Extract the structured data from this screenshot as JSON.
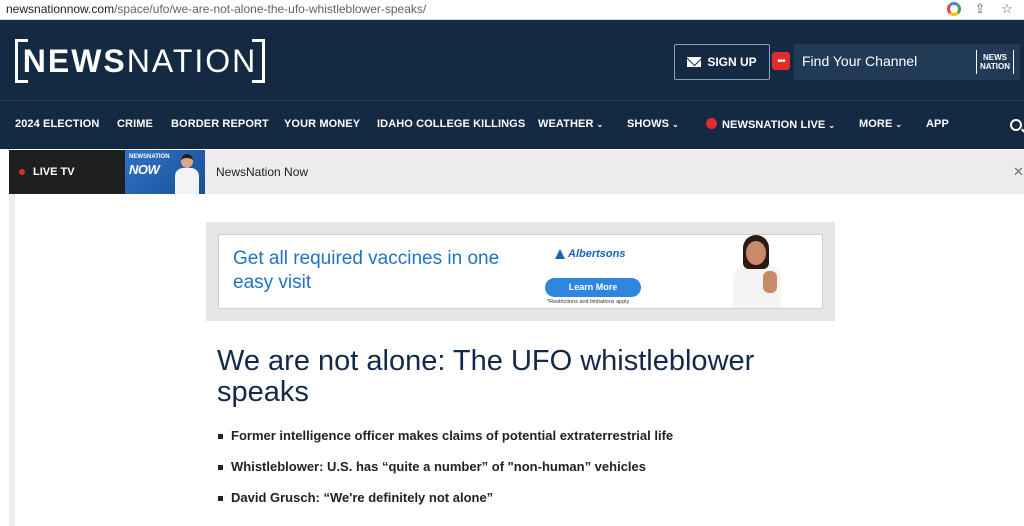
{
  "browser": {
    "url_domain": "newsnationnow.com",
    "url_path": "/space/ufo/we-are-not-alone-the-ufo-whistleblower-speaks/"
  },
  "header": {
    "logo_bold": "NEWS",
    "logo_light": "NATION",
    "signup_label": "SIGN UP",
    "channel_icon": "•••",
    "find_channel_label": "Find Your Channel",
    "mini_logo_line1": "NEWS",
    "mini_logo_line2": "NATION"
  },
  "nav": {
    "items": [
      {
        "label": "2024 ELECTION"
      },
      {
        "label": "CRIME"
      },
      {
        "label": "BORDER REPORT"
      },
      {
        "label": "YOUR MONEY"
      },
      {
        "label": "IDAHO COLLEGE KILLINGS"
      },
      {
        "label": "WEATHER"
      },
      {
        "label": "SHOWS"
      },
      {
        "label": "NEWSNATION LIVE"
      },
      {
        "label": "MORE"
      },
      {
        "label": "APP"
      }
    ]
  },
  "livebar": {
    "live_tv_label": "LIVE TV",
    "thumb_brand": "NEWSNATION",
    "thumb_show": "NOW",
    "program_label": "NewsNation Now",
    "close_label": "✕"
  },
  "ad": {
    "headline": "Get all required vaccines in one easy visit",
    "brand": "Albertsons",
    "cta": "Learn More",
    "disclaimer": "*Restrictions and limitations apply"
  },
  "article": {
    "title": "We are not alone: The UFO whistleblower speaks",
    "bullets": [
      "Former intelligence officer makes claims of potential extraterrestrial life",
      "Whistleblower: U.S. has “quite a number” of \"non-human” vehicles",
      "David Grusch: “We're definitely not alone”"
    ]
  },
  "colors": {
    "header_bg": "#142a42",
    "live_red": "#e32b2b",
    "ad_blue": "#1f73c7",
    "headline": "#13294b"
  }
}
